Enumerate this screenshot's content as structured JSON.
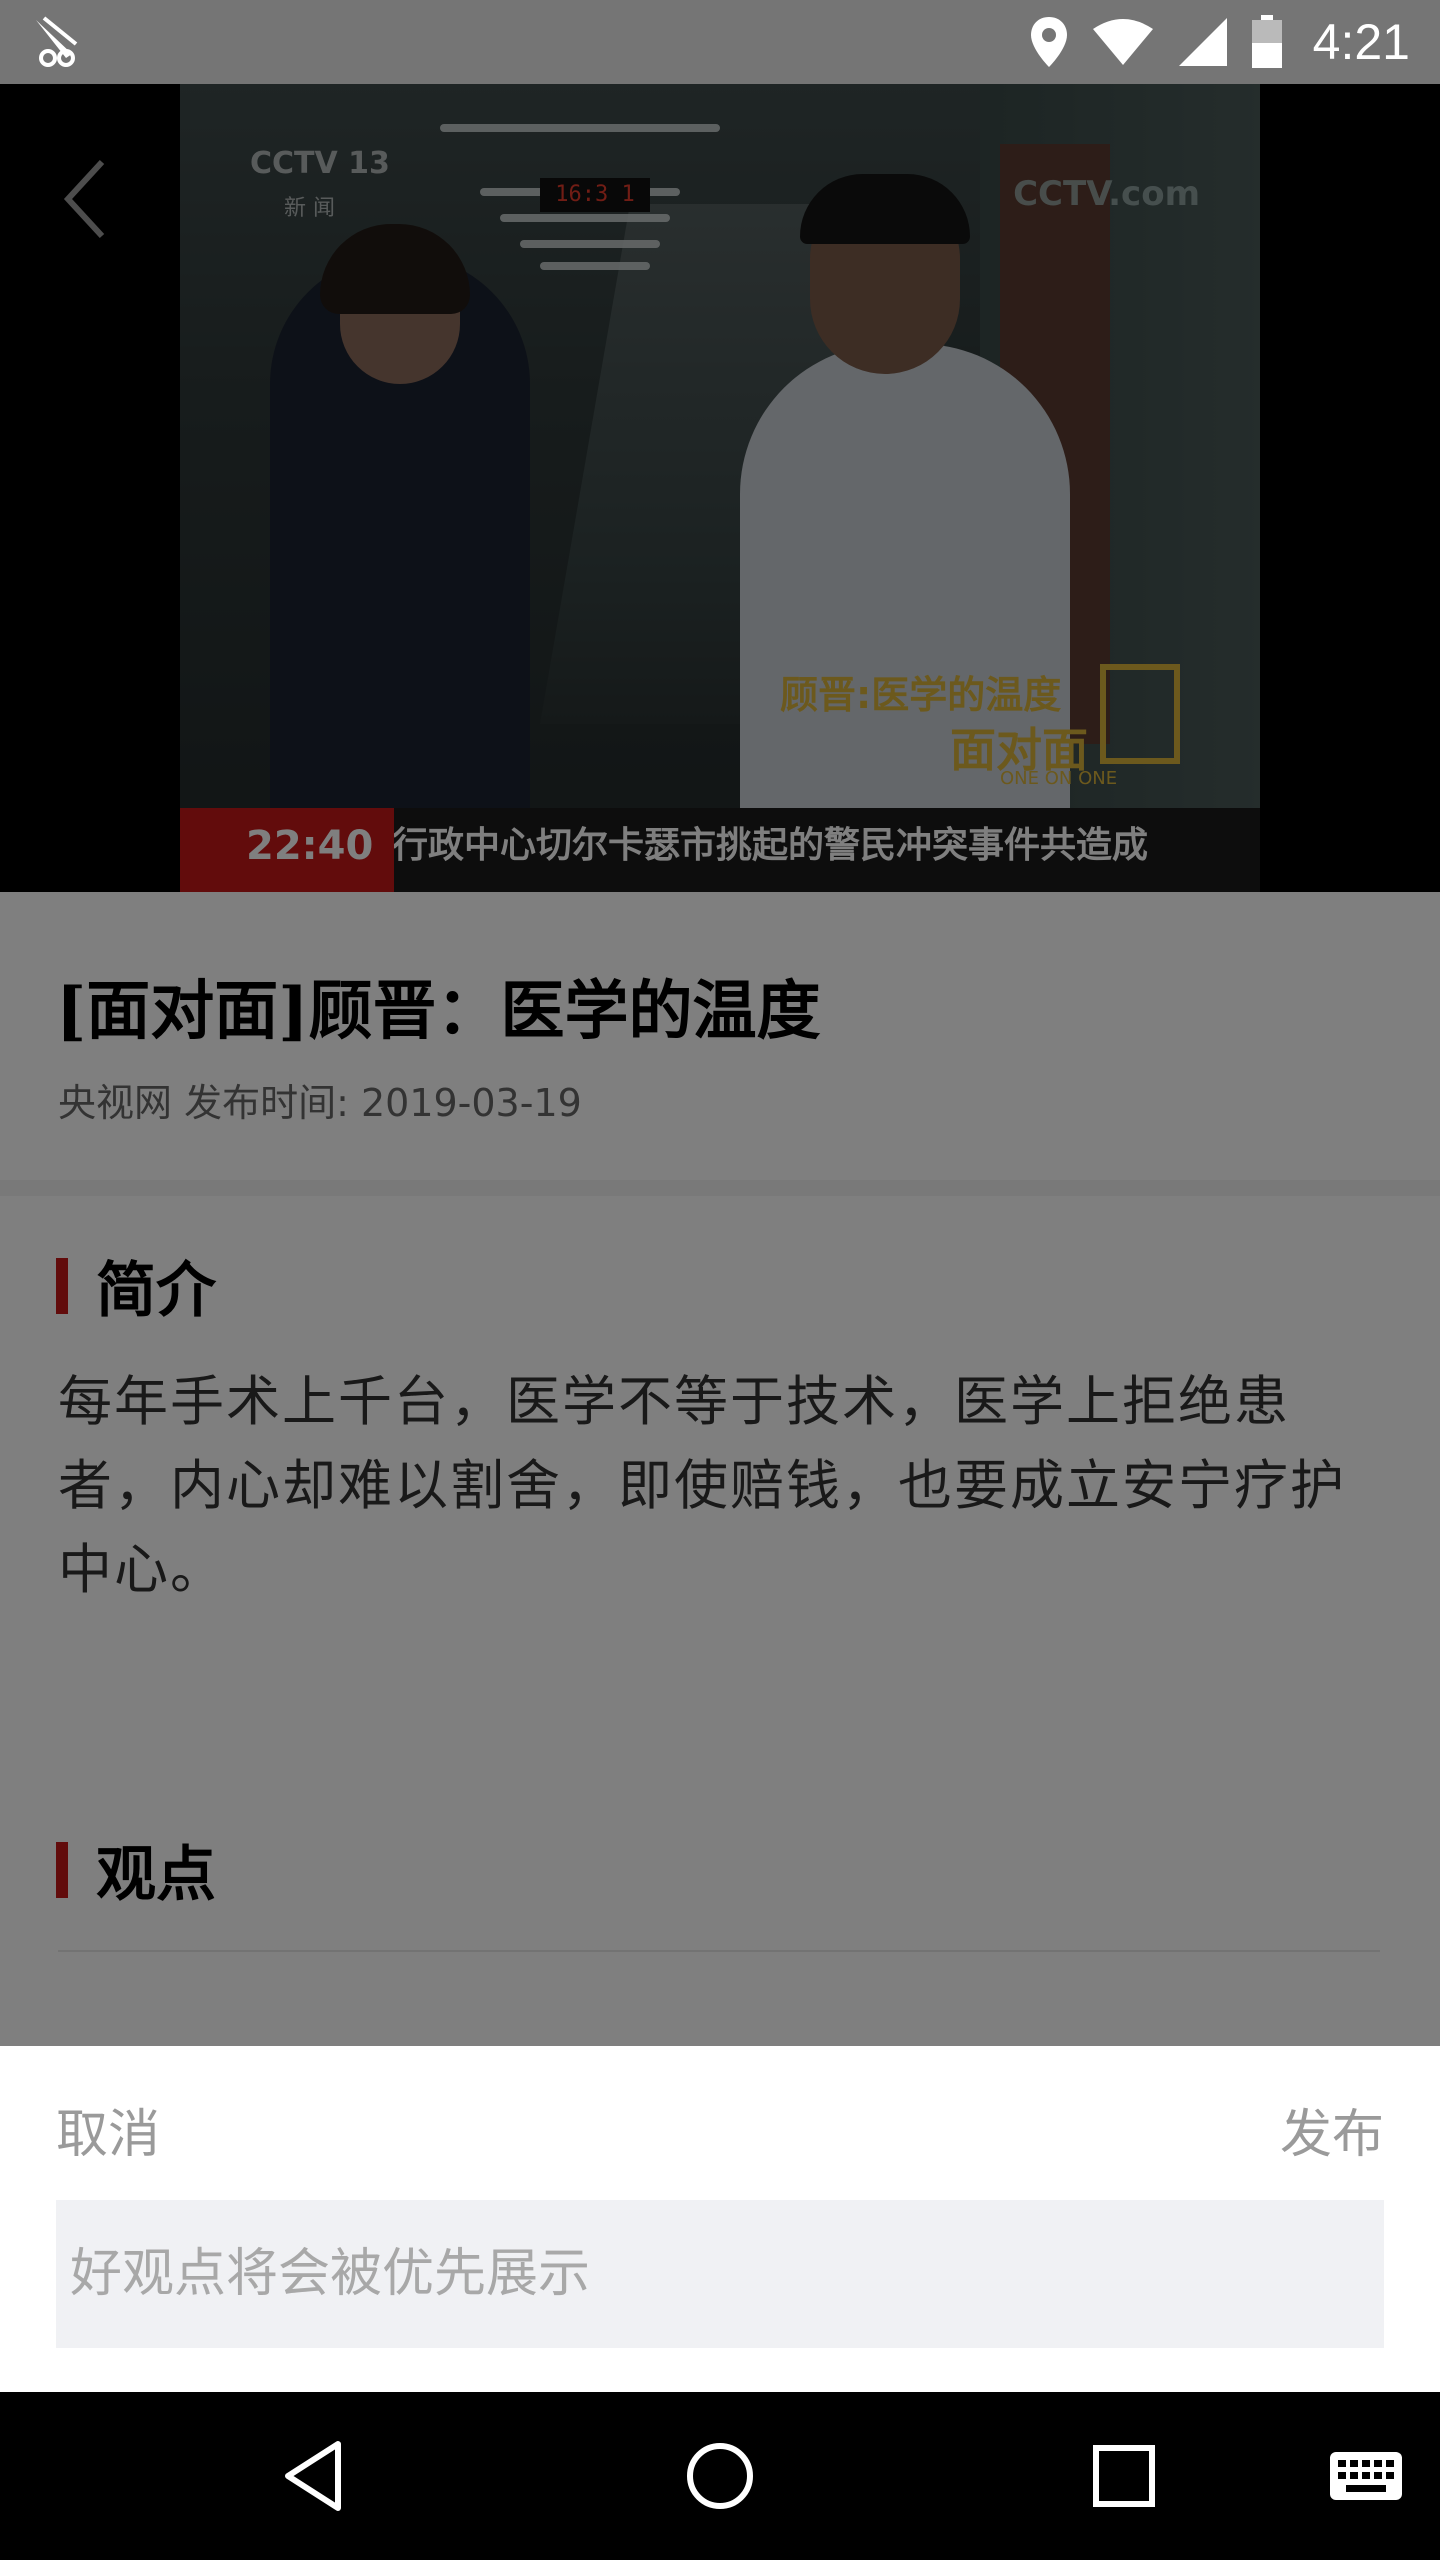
{
  "status_bar": {
    "time": "4:21",
    "icons": [
      "location-icon",
      "wifi-icon",
      "signal-icon",
      "battery-icon"
    ]
  },
  "video": {
    "channel_logo": "CCTV 13",
    "channel_sub": "新 闻",
    "clock": "16:3 1",
    "watermark": "CCTV.com",
    "overlay_title": "顾晋:医学的温度",
    "overlay_show": "面对面",
    "overlay_show_en": "ONE ON ONE",
    "ticker_time": "22:40",
    "ticker_text": "行政中心切尔卡瑟市挑起的警民冲突事件共造成",
    "progress": 0.046
  },
  "article": {
    "title": "[面对面]顾晋：医学的温度",
    "meta": "央视网 发布时间: 2019-03-19",
    "intro_heading": "简介",
    "intro_text": "每年手术上千台，医学不等于技术，医学上拒绝患者，内心却难以割舍，即使赔钱，也要成立安宁疗护中心。",
    "opinion_heading": "观点"
  },
  "comment_sheet": {
    "cancel_label": "取消",
    "publish_label": "发布",
    "placeholder": "好观点将会被优先展示"
  },
  "colors": {
    "accent": "#c51818",
    "status_bar": "#757575"
  }
}
